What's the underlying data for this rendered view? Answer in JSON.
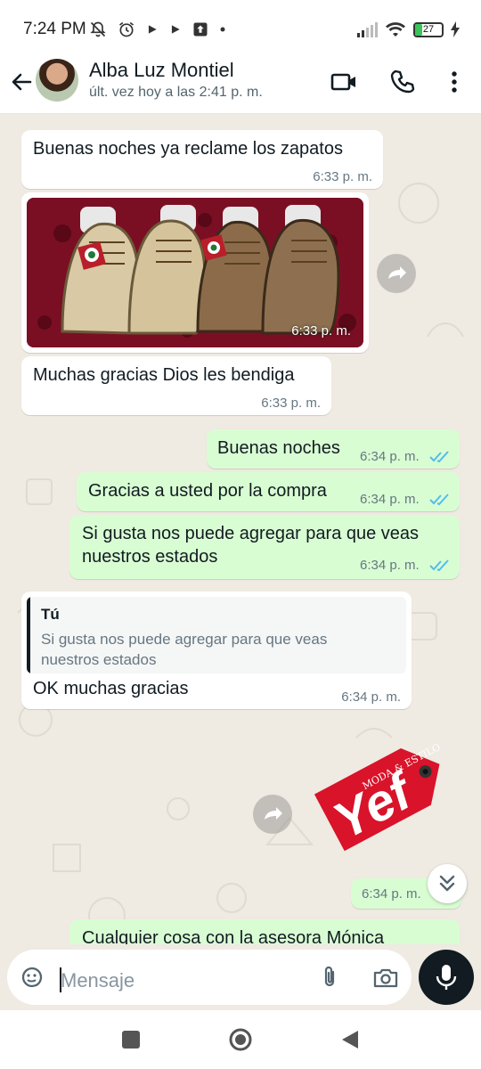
{
  "status_bar": {
    "time": "7:24 PM",
    "battery": "27"
  },
  "header": {
    "name": "Alba Luz Montiel",
    "last_seen": "últ. vez hoy a las 2:41 p. m."
  },
  "messages": {
    "m1": {
      "text": "Buenas noches ya reclame los zapatos",
      "time": "6:33 p. m."
    },
    "m2": {
      "time": "6:33 p. m."
    },
    "m3": {
      "text": "Muchas gracias Dios les bendiga",
      "time": "6:33 p. m."
    },
    "m4": {
      "text": "Buenas noches",
      "time": "6:34 p. m."
    },
    "m5": {
      "text": "Gracias a usted por la compra",
      "time": "6:34 p. m."
    },
    "m6": {
      "line1": "Si gusta nos puede agregar para que veas",
      "line2": "nuestros estados",
      "time": "6:34 p. m."
    },
    "m7": {
      "quote_author": "Tú",
      "quote_text": "Si gusta nos puede agregar para que veas nuestros estados",
      "text": "OK muchas gracias",
      "time": "6:34 p. m."
    },
    "m8": {
      "sticker_small": "MODA & ESTILO",
      "sticker_big": "Yef"
    },
    "m9": {
      "time": "6:34 p. m."
    },
    "m10": {
      "text": "Cualquier cosa con la asesora Mónica"
    }
  },
  "input": {
    "placeholder": "Mensaje"
  },
  "colors": {
    "incoming": "#ffffff",
    "outgoing": "#d9fdd3",
    "chat_bg": "#efeae2",
    "read_ticks": "#53bdeb",
    "sticker_red": "#d8132a"
  },
  "icons": {
    "status_left": [
      "notifications-off-icon",
      "alarm-icon",
      "play-icon",
      "play-icon",
      "upload-icon",
      "dot-icon"
    ],
    "status_right": [
      "signal-icon",
      "wifi-icon",
      "battery-icon",
      "charging-icon"
    ],
    "header": [
      "back-arrow-icon",
      "video-call-icon",
      "phone-icon",
      "more-vert-icon"
    ],
    "chat": [
      "forward-icon",
      "read-ticks-icon",
      "double-chevron-down-icon"
    ],
    "input": [
      "sticker-icon",
      "attach-icon",
      "camera-icon",
      "mic-icon"
    ],
    "nav": [
      "recents-icon",
      "home-icon",
      "back-triangle-icon"
    ]
  }
}
